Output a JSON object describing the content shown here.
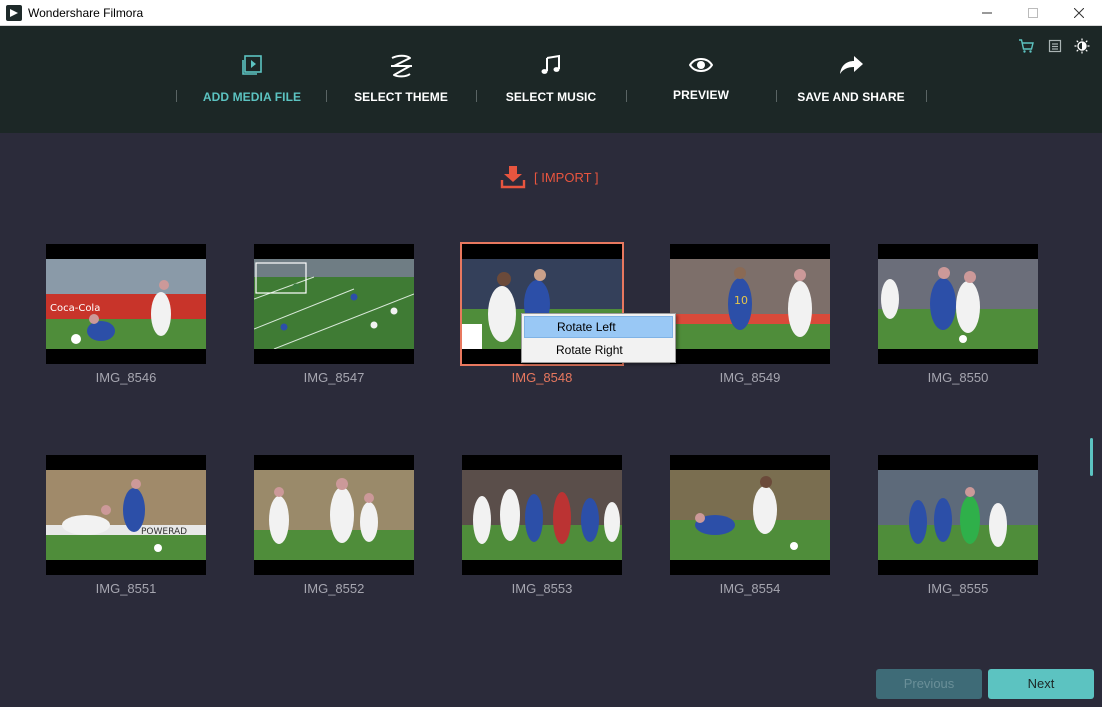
{
  "window": {
    "title": "Wondershare Filmora"
  },
  "nav": {
    "steps": [
      {
        "label": "ADD MEDIA FILE",
        "icon": "media-file-icon",
        "active": true
      },
      {
        "label": "SELECT THEME",
        "icon": "theme-icon",
        "active": false
      },
      {
        "label": "SELECT MUSIC",
        "icon": "music-note-icon",
        "active": false
      },
      {
        "label": "PREVIEW",
        "icon": "eye-icon",
        "active": false
      },
      {
        "label": "SAVE AND SHARE",
        "icon": "share-arrow-icon",
        "active": false
      }
    ],
    "tools": [
      "cart-icon",
      "menu-icon",
      "brightness-icon"
    ]
  },
  "import": {
    "label": "[ IMPORT ]",
    "icon": "download-icon"
  },
  "media": [
    {
      "name": "IMG_8546"
    },
    {
      "name": "IMG_8547"
    },
    {
      "name": "IMG_8548",
      "selected": true
    },
    {
      "name": "IMG_8549"
    },
    {
      "name": "IMG_8550"
    },
    {
      "name": "IMG_8551"
    },
    {
      "name": "IMG_8552"
    },
    {
      "name": "IMG_8553"
    },
    {
      "name": "IMG_8554"
    },
    {
      "name": "IMG_8555"
    }
  ],
  "context_menu": {
    "items": [
      "Rotate Left",
      "Rotate Right"
    ],
    "hovered": "Rotate Left"
  },
  "footer": {
    "previous_label": "Previous",
    "next_label": "Next"
  },
  "colors": {
    "accent": "#5cc3c1",
    "selected": "#e8785f",
    "import": "#e8553f",
    "nav_bg": "#1c2726",
    "main_bg": "#2b2b3a"
  }
}
